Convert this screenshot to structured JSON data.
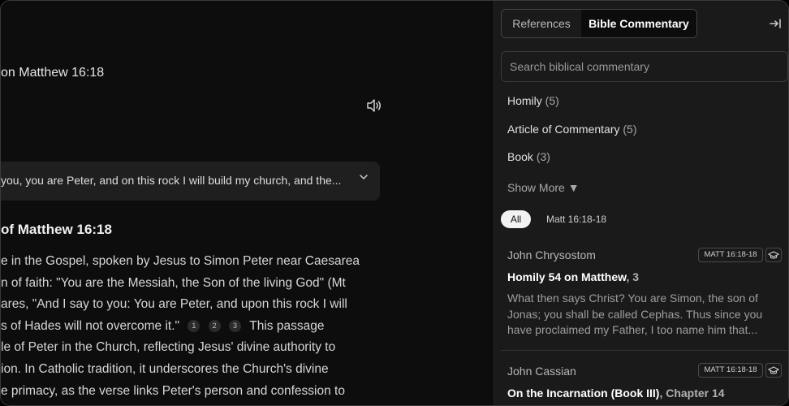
{
  "main": {
    "page_title": "on Matthew 16:18",
    "speaker_icon": "speaker-icon",
    "verse_preview": "you, you are Peter, and on this rock I will build my church, and the...",
    "section_title": "of Matthew 16:18",
    "body_lines": [
      "e in the Gospel, spoken by Jesus to Simon Peter near Caesarea",
      "n of faith: \"You are the Messiah, the Son of the living God\" (Mt",
      "ares, \"And I say to you: You are Peter, and upon this rock I will",
      "s of Hades will not overcome it.\"",
      "le of Peter in the Church, reflecting Jesus' divine authority to",
      "ion. In Catholic tradition, it underscores the Church's divine",
      "e primacy, as the verse links Peter's person and confession to"
    ],
    "footnotes": [
      "1",
      "2",
      "3"
    ],
    "line4_tail": "This passage"
  },
  "sidebar": {
    "tabs": [
      {
        "label": "References"
      },
      {
        "label": "Bible Commentary"
      }
    ],
    "collapse_icon": "collapse-right-icon",
    "search": {
      "placeholder": "Search biblical commentary",
      "value": ""
    },
    "filters": [
      {
        "label": "Homily",
        "count": "(5)"
      },
      {
        "label": "Article of Commentary",
        "count": "(5)"
      },
      {
        "label": "Book",
        "count": "(3)"
      }
    ],
    "show_more": "Show More ▼",
    "ref_pills": {
      "all": "All",
      "ref": "Matt 16:18-18"
    },
    "results": [
      {
        "author": "John Chrysostom",
        "badge": "MATT 16:18-18",
        "title": "Homily 54 on Matthew",
        "chapter": ", 3",
        "excerpt": "What then says Christ? You are Simon, the son of Jonas; you shall be called Cephas. Thus since you have proclaimed my Father, I too name him that..."
      },
      {
        "author": "John Cassian",
        "badge": "MATT 16:18-18",
        "title": "On the Incarnation (Book III)",
        "chapter": ", Chapter 14"
      }
    ]
  }
}
